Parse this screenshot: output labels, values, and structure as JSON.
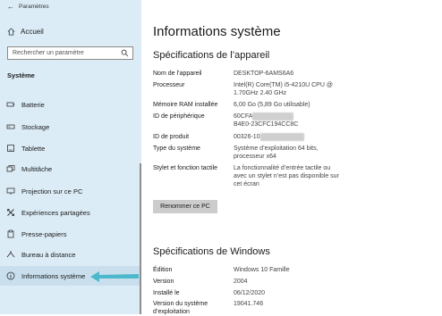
{
  "window": {
    "title": "Paramètres"
  },
  "sidebar": {
    "home": "Accueil",
    "search_placeholder": "Rechercher un paramètre",
    "section": "Système",
    "items": [
      {
        "label": "Batterie",
        "icon": "battery-icon"
      },
      {
        "label": "Stockage",
        "icon": "storage-icon"
      },
      {
        "label": "Tablette",
        "icon": "tablet-icon"
      },
      {
        "label": "Multitâche",
        "icon": "multitask-icon"
      },
      {
        "label": "Projection sur ce PC",
        "icon": "projection-icon"
      },
      {
        "label": "Expériences partagées",
        "icon": "shared-experiences-icon"
      },
      {
        "label": "Presse-papiers",
        "icon": "clipboard-icon"
      },
      {
        "label": "Bureau à distance",
        "icon": "remote-desktop-icon"
      },
      {
        "label": "Informations système",
        "icon": "info-icon"
      }
    ]
  },
  "main": {
    "title": "Informations système",
    "device_specs": {
      "heading": "Spécifications de l’appareil",
      "device_name_label": "Nom de l’appareil",
      "device_name": "DESKTOP-6AMS6A6",
      "processor_label": "Processeur",
      "processor_line1": "Intel(R) Core(TM) i5-4210U CPU @",
      "processor_line2": "1.70GHz   2.40 GHz",
      "ram_label": "Mémoire RAM installée",
      "ram": "6,00 Go (5,89 Go utilisable)",
      "device_id_label": "ID de périphérique",
      "device_id_line1": "60CFA",
      "device_id_line2": "B4E0-23CFC194CC8C",
      "product_id_label": "ID de produit",
      "product_id": "00326-10",
      "system_type_label": "Type du système",
      "system_type_line1": "Système d’exploitation 64 bits,",
      "system_type_line2": "processeur x64",
      "pen_touch_label": "Stylet et fonction tactile",
      "pen_touch_line1": "La fonctionnalité d’entrée tactile ou",
      "pen_touch_line2": "avec un stylet n’est pas disponible sur",
      "pen_touch_line3": "cet écran",
      "rename_button": "Renommer ce PC"
    },
    "windows_specs": {
      "heading": "Spécifications de Windows",
      "edition_label": "Édition",
      "edition": "Windows 10 Famille",
      "version_label": "Version",
      "version": "2004",
      "installed_label": "Installé le",
      "installed": "06/12/2020",
      "os_build_label_line1": "Version du système",
      "os_build_label_line2": "d’exploitation",
      "os_build": "19041.746"
    }
  },
  "colors": {
    "sidebar_bg": "#dcecf7",
    "pointer_arrow": "#3fb4c6",
    "button_bg": "#cccccc"
  }
}
